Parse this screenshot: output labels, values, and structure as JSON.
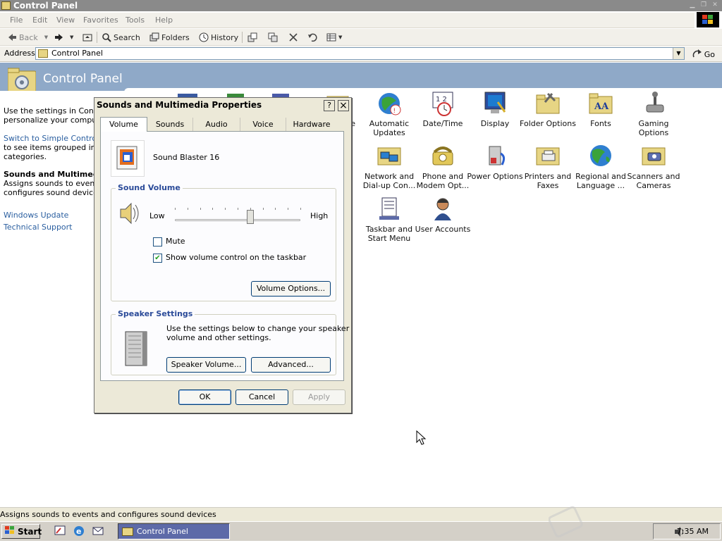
{
  "window": {
    "title": "Control Panel"
  },
  "menubar": [
    "File",
    "Edit",
    "View",
    "Favorites",
    "Tools",
    "Help"
  ],
  "toolbar": {
    "back": "Back",
    "search": "Search",
    "folders": "Folders",
    "history": "History"
  },
  "address": {
    "label": "Address",
    "value": "Control Panel",
    "go": "Go"
  },
  "banner": {
    "title": "Control Panel"
  },
  "left_pane": {
    "intro_1": "Use the settings in Control",
    "intro_2": "personalize your computer",
    "switch_link": "Switch to Simple Control Pa",
    "switch_1": "to see items grouped into",
    "switch_2": "categories.",
    "selected_title": "Sounds and Multimedia",
    "selected_1": "Assigns sounds to events a",
    "selected_2": "configures sound devices",
    "link_update": "Windows Update",
    "link_support": "Technical Support"
  },
  "icons": [
    {
      "l1": "ve",
      "l2": ""
    },
    {
      "l1": "Automatic",
      "l2": "Updates"
    },
    {
      "l1": "Date/Time",
      "l2": ""
    },
    {
      "l1": "Display",
      "l2": ""
    },
    {
      "l1": "Folder Options",
      "l2": ""
    },
    {
      "l1": "Fonts",
      "l2": ""
    },
    {
      "l1": "Gaming",
      "l2": "Options"
    },
    {
      "l1": "Network and",
      "l2": "Dial-up Con..."
    },
    {
      "l1": "Phone and",
      "l2": "Modem Opt..."
    },
    {
      "l1": "Power Options",
      "l2": ""
    },
    {
      "l1": "Printers and",
      "l2": "Faxes"
    },
    {
      "l1": "Regional and",
      "l2": "Language ..."
    },
    {
      "l1": "Scanners and",
      "l2": "Cameras"
    },
    {
      "l1": "Taskbar and",
      "l2": "Start Menu"
    },
    {
      "l1": "User Accounts",
      "l2": ""
    }
  ],
  "dialog": {
    "title": "Sounds and Multimedia Properties",
    "help": "?",
    "close": "×",
    "tabs": [
      "Volume",
      "Sounds",
      "Audio",
      "Voice",
      "Hardware"
    ],
    "device": "Sound Blaster 16",
    "sound_volume": {
      "label": "Sound Volume",
      "low": "Low",
      "high": "High",
      "level": 0.6,
      "mute_label": "Mute",
      "mute_checked": false,
      "show_label": "Show volume control on the taskbar",
      "show_checked": true,
      "options_button": "Volume Options..."
    },
    "speaker": {
      "label": "Speaker Settings",
      "desc_1": "Use the settings below to change your speaker",
      "desc_2": "volume and other settings.",
      "volume_button": "Speaker Volume...",
      "advanced_button": "Advanced..."
    },
    "buttons": {
      "ok": "OK",
      "cancel": "Cancel",
      "apply": "Apply"
    }
  },
  "statusbar": {
    "text": "Assigns sounds to events and configures sound devices"
  },
  "taskbar": {
    "start": "Start",
    "task": "Control Panel",
    "clock": "7:35 AM"
  },
  "colors": {
    "banner": "#8fa9c8",
    "task_active": "#5d6aa8",
    "group_label": "#2b4b99",
    "link": "#2b5fa0"
  }
}
